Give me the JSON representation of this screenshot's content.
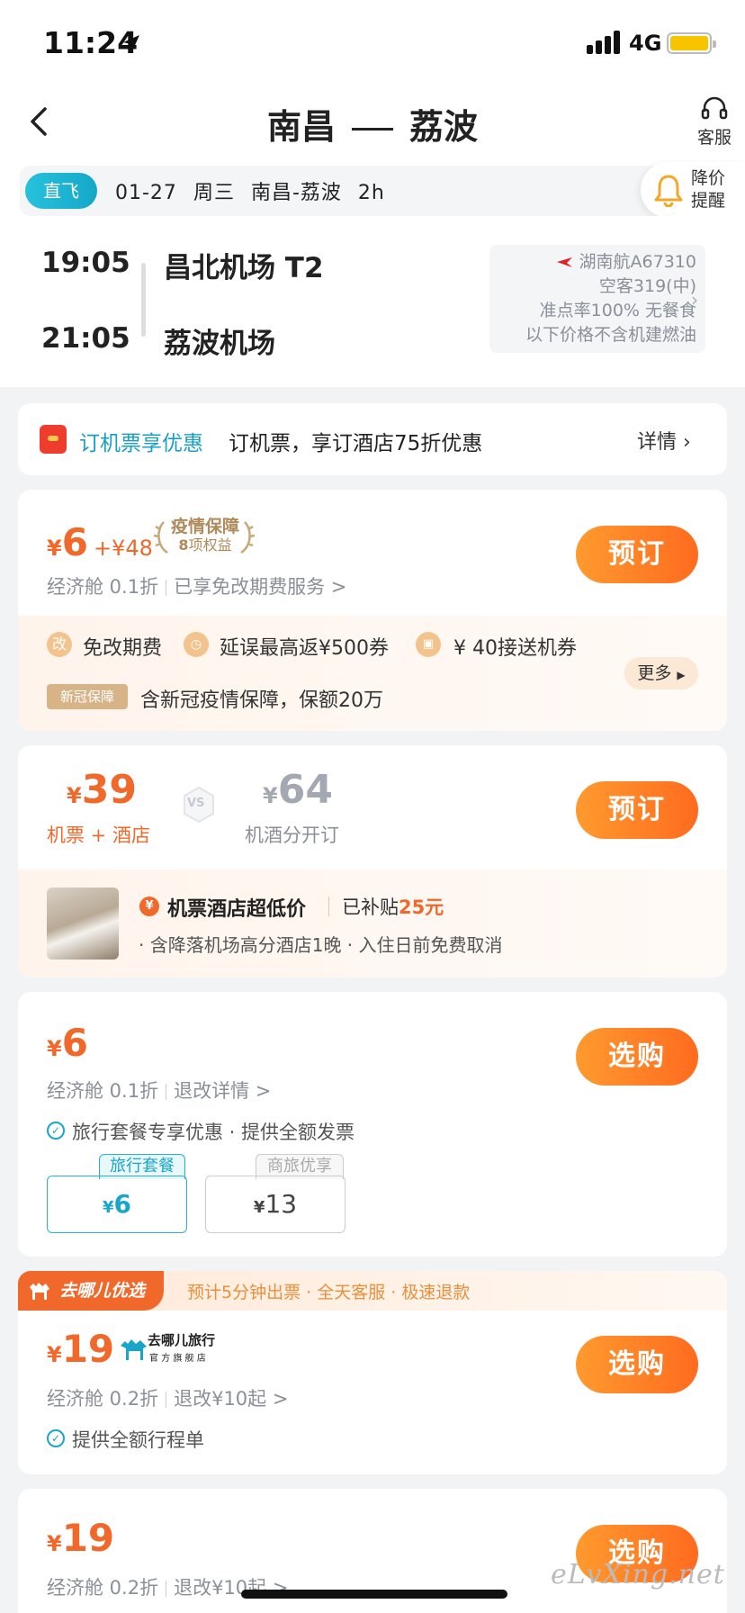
{
  "status": {
    "time": "11:24",
    "network": "4G"
  },
  "header": {
    "from": "南昌",
    "to": "荔波",
    "service_label": "客服"
  },
  "infobar": {
    "tag": "直飞",
    "date": "01-27",
    "weekday": "周三",
    "route": "南昌-荔波",
    "duration": "2h",
    "alert_label": "降价提醒"
  },
  "flight": {
    "dep_time": "19:05",
    "dep_airport": "昌北机场 T2",
    "arr_time": "21:05",
    "arr_airport": "荔波机场",
    "airline": "湖南航A67310",
    "aircraft": "空客319(中)",
    "info": "准点率100% 无餐食",
    "note": "以下价格不含机建燃油"
  },
  "promo": {
    "title": "订机票享优惠",
    "text": "订机票，享订酒店75折优惠",
    "more": "详情 ›"
  },
  "card1": {
    "currency": "¥",
    "price": "6",
    "addon": "+¥48",
    "laurel_title": "疫情保障",
    "laurel_count": "8",
    "laurel_sub": "项权益",
    "cabin": "经济舱 0.1折",
    "service": "已享免改期费服务 >",
    "button": "预订",
    "benefits": [
      {
        "icon": "改",
        "text": "免改期费"
      },
      {
        "icon": "clock-icon",
        "text": "延误最高返¥500券"
      },
      {
        "icon": "car-icon",
        "text": "¥ 40接送机券"
      }
    ],
    "tag": "新冠保障",
    "tag_text": "含新冠疫情保障，保额20万",
    "more": "更多"
  },
  "card2": {
    "currency": "¥",
    "price": "39",
    "price_label": "机票 + 酒店",
    "vs": "VS",
    "alt_currency": "¥",
    "alt_price": "64",
    "alt_label": "机酒分开订",
    "button": "预订",
    "coin": "¥",
    "bundle_title": "机票酒店超低价",
    "subsidy_label": "已补贴",
    "subsidy": "25元",
    "detail": "· 含降落机场高分酒店1晚 · 入住日前免费取消"
  },
  "card3": {
    "currency": "¥",
    "price": "6",
    "cabin": "经济舱 0.1折",
    "refund": "退改详情 >",
    "feature": "旅行套餐专享优惠 · 提供全额发票",
    "button": "选购",
    "options": [
      {
        "tag": "旅行套餐",
        "currency": "¥",
        "price": "6"
      },
      {
        "tag": "商旅优享",
        "currency": "¥",
        "price": "13"
      }
    ]
  },
  "card4": {
    "badge": "去哪儿优选",
    "promo": "预计5分钟出票 · 全天客服 · 极速退款",
    "currency": "¥",
    "price": "19",
    "brand": "去哪儿旅行",
    "brand_sub": "官 方 旗 舰 店",
    "cabin": "经济舱 0.2折",
    "refund": "退改¥10起 >",
    "feature": "提供全额行程单",
    "button": "选购"
  },
  "card5": {
    "currency": "¥",
    "price": "19",
    "cabin": "经济舱 0.2折",
    "refund": "退改¥10起 >",
    "button": "选购"
  },
  "watermark": "eLvXing.net",
  "colors": {
    "accent": "#f0682a",
    "teal": "#1aa6c9"
  }
}
